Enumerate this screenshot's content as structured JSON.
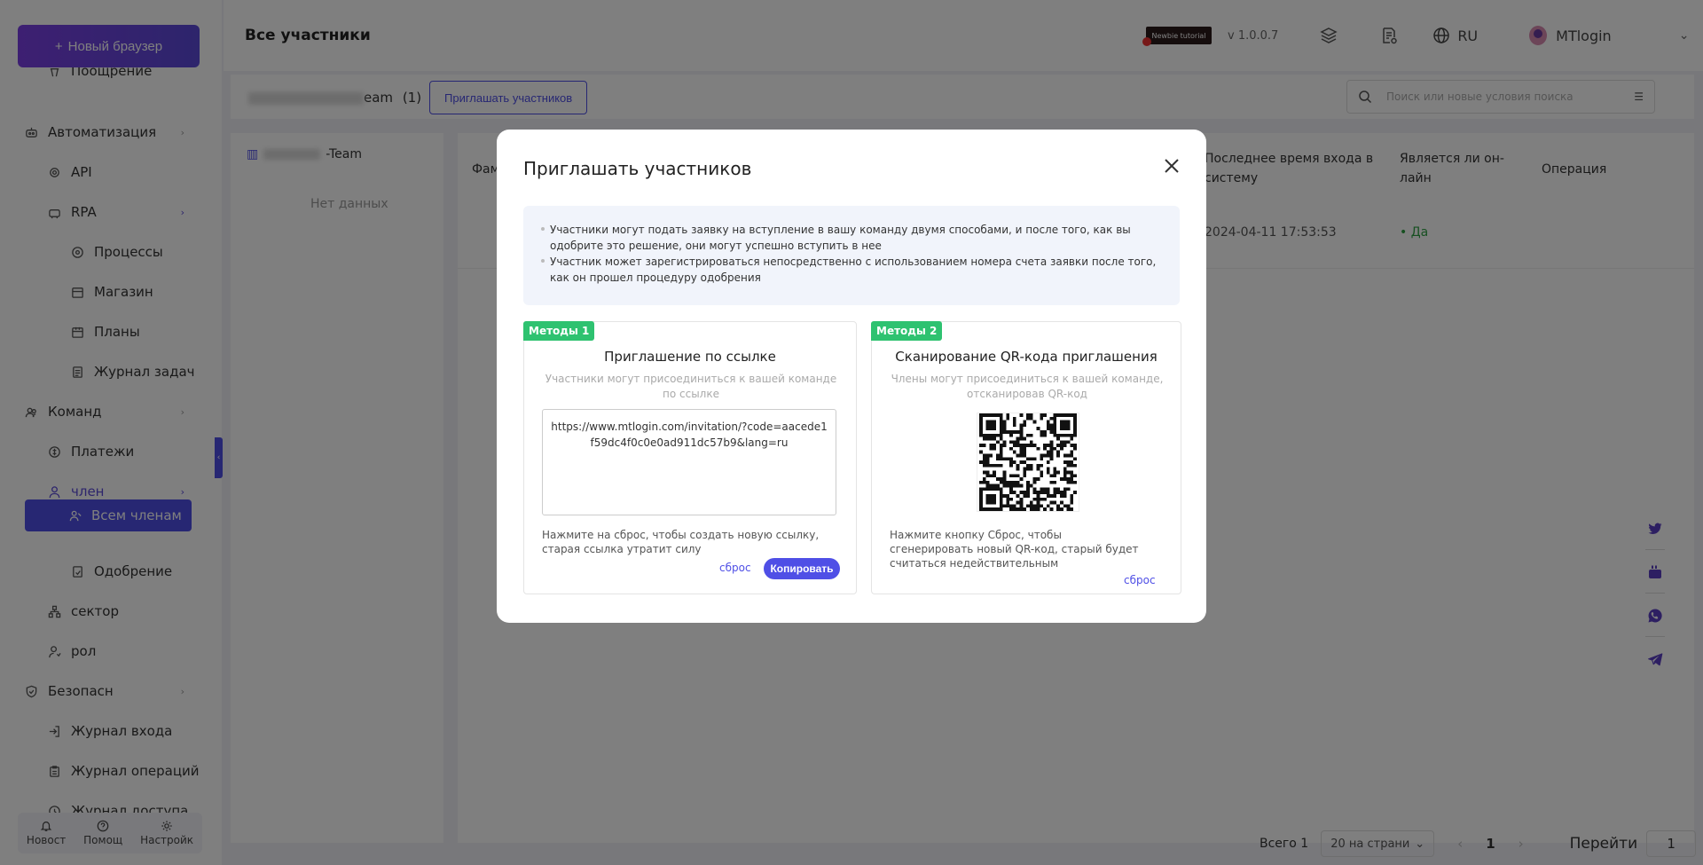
{
  "sidebar": {
    "new_browser": "Новый браузер",
    "items": [
      {
        "label": "Поощрение"
      },
      {
        "label": "Автоматизация"
      },
      {
        "label": "API"
      },
      {
        "label": "RPA"
      },
      {
        "label": "Процессы"
      },
      {
        "label": "Магазин"
      },
      {
        "label": "Планы"
      },
      {
        "label": "Журнал задач"
      },
      {
        "label": "Команд"
      },
      {
        "label": "Платежи"
      },
      {
        "label": "член"
      },
      {
        "label": "Всем членам"
      },
      {
        "label": "Одобрение"
      },
      {
        "label": "сектор"
      },
      {
        "label": "рол"
      },
      {
        "label": "Безопасн"
      },
      {
        "label": "Журнал входа"
      },
      {
        "label": "Журнал операций"
      },
      {
        "label": "Журнал доступа"
      }
    ],
    "bottom": {
      "news": "Новост",
      "help": "Помощ",
      "settings": "Настройк"
    }
  },
  "header": {
    "title": "Все участники",
    "newbie": "Newbie tutorial",
    "version": "v 1.0.0.7",
    "lang": "RU",
    "user": "MTlogin"
  },
  "toolbar": {
    "team_suffix": "eam",
    "team_count": "(1)",
    "invite_button": "Приглашать участников",
    "search_placeholder": "Поиск или новые условия поиска"
  },
  "tree": {
    "team_suffix": "-Team",
    "no_data": "Нет данных"
  },
  "table": {
    "headers": {
      "name": "Фам",
      "last_login": "Последнее время входа в систему",
      "online": "Является ли он-лайн",
      "operation": "Операция"
    },
    "row": {
      "last_login": "2024-04-11 17:53:53",
      "online": "• Да"
    }
  },
  "pager": {
    "total": "Всего 1",
    "page_size": "20 на страни",
    "page": "1",
    "goto": "Перейти",
    "goto_value": "1"
  },
  "modal": {
    "title": "Приглашать участников",
    "notice1": "Участники могут подать заявку на вступление в вашу команду двумя способами, и после того, как вы одобрите это решение, они могут успешно вступить в нее",
    "notice2": "Участник может зарегистрироваться непосредственно с использованием номера счета заявки после того, как он прошел процедуру одобрения",
    "method1": {
      "tag": "Методы 1",
      "title": "Приглашение по ссылке",
      "subtitle": "Участники могут присоединиться к вашей команде по ссылке",
      "link": "https://www.mtlogin.com/invitation/?code=aacede1f59dc4f0c0e0ad911dc57b9&lang=ru",
      "note": "Нажмите на сброс, чтобы создать новую ссылку, старая ссылка утратит силу",
      "reset": "сброс",
      "copy": "Копировать"
    },
    "method2": {
      "tag": "Методы 2",
      "title": "Сканирование QR-кода приглашения",
      "subtitle": "Члены могут присоединиться к вашей команде, отсканировав QR-код",
      "note": "Нажмите кнопку Сброс, чтобы сгенерировать новый QR-код, старый будет считаться недействительным",
      "reset": "сброс"
    }
  },
  "colors": {
    "accent": "#4f4fe6",
    "tag_green": "#2ec270",
    "purple": "#7b3fe4"
  }
}
